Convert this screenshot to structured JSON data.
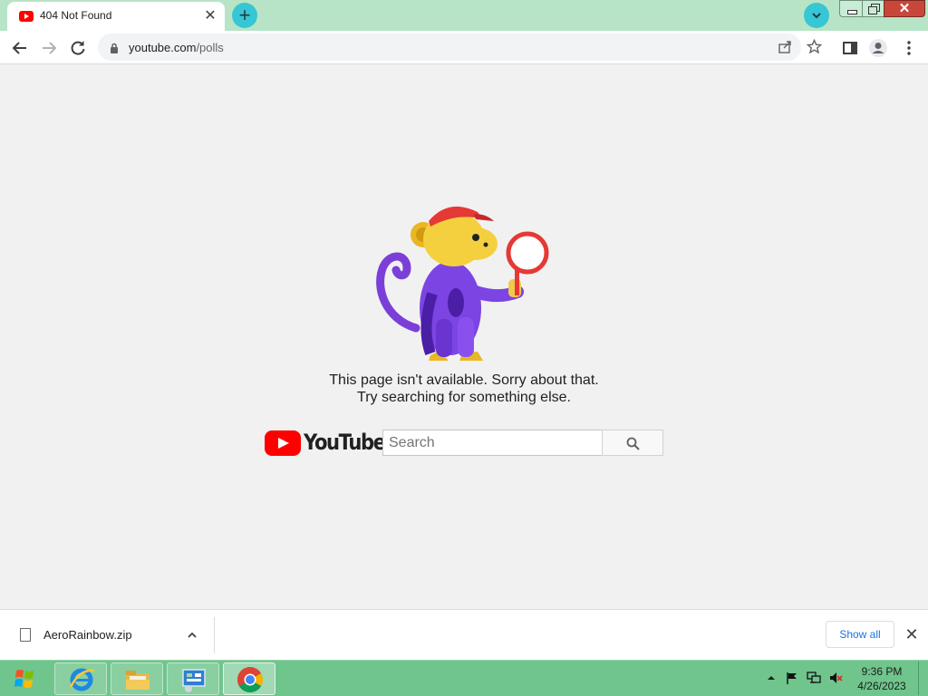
{
  "browser": {
    "tab": {
      "title": "404 Not Found"
    },
    "address_bar": {
      "url_host": "youtube.com",
      "url_path": "/polls"
    }
  },
  "page": {
    "message_line1": "This page isn't available. Sorry about that.",
    "message_line2": "Try searching for something else.",
    "logo_text": "YouTube",
    "search": {
      "placeholder": "Search",
      "value": ""
    },
    "colors": {
      "brand_red": "#ff0000",
      "background": "#f1f1f1"
    }
  },
  "downloads": {
    "file_name": "AeroRainbow.zip",
    "show_all_label": "Show all"
  },
  "taskbar": {
    "time": "9:36 PM",
    "date": "4/26/2023",
    "pinned": [
      "internet-explorer-icon",
      "file-explorer-icon",
      "control-panel-icon",
      "chrome-icon"
    ]
  }
}
